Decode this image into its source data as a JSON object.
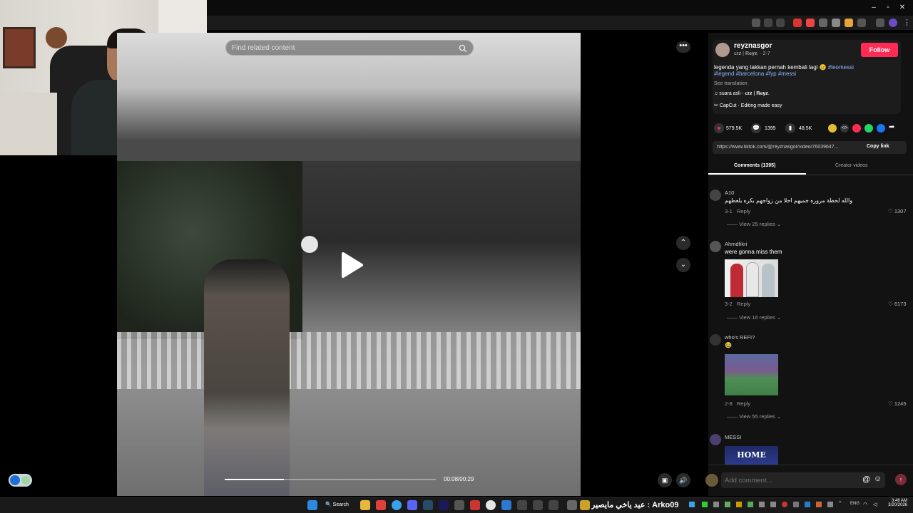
{
  "search": {
    "placeholder": "Find related content"
  },
  "player": {
    "time": "00:08/00:29",
    "progress_fraction": 0.28
  },
  "post": {
    "username": "reyznasgor",
    "subtitle": "𝐜𝐫𝐳 | 𝐑𝐞𝐲𝐳. · 2-7",
    "follow_label": "Follow",
    "caption_text": "legenda yang takkan pernah kembali lagi 😢",
    "hashtags_line1": "#leomessi",
    "hashtags_line2": "#legend #barcelona #fyp #messi",
    "see_translation": "See translation",
    "music": "suara asli - 𝐜𝐫𝐳 | 𝐑𝐞𝐲𝐳.",
    "capcut": "CapCut · Editing made easy"
  },
  "stats": {
    "likes": "579.5K",
    "comments": "1395",
    "saves": "48.5K"
  },
  "link": {
    "url": "https://www.tiktok.com/@reyznasgor/video/76039647...",
    "copy_label": "Copy link"
  },
  "tabs": {
    "comments": "Comments (1395)",
    "creator": "Creator videos"
  },
  "comments": [
    {
      "name": "A10",
      "text": "والله لحظة مروره جميهم احلا من زواجهم بكره يلعطهم",
      "date": "3-1",
      "reply": "Reply",
      "likes": "1307",
      "view_replies": "View 25 replies"
    },
    {
      "name": "Ahmdfikri",
      "text": "were gonna miss them",
      "date": "3-2",
      "reply": "Reply",
      "likes": "6173",
      "view_replies": "View 16 replies"
    },
    {
      "name": "who's REFI?",
      "text": "😂",
      "date": "2-8",
      "reply": "Reply",
      "likes": "1245",
      "view_replies": "View 55 replies"
    },
    {
      "name": "MESSI",
      "image_text": "HOME"
    }
  ],
  "add_comment": {
    "placeholder": "Add comment..."
  },
  "taskbar": {
    "search": "Search",
    "tray_text": "عيد ياخي مايصير : Arko09",
    "lang": "ENG",
    "time": "3:46 AM",
    "date": "3/20/2026"
  },
  "colors": {
    "accent": "#fe2c55",
    "panel": "#121212"
  }
}
